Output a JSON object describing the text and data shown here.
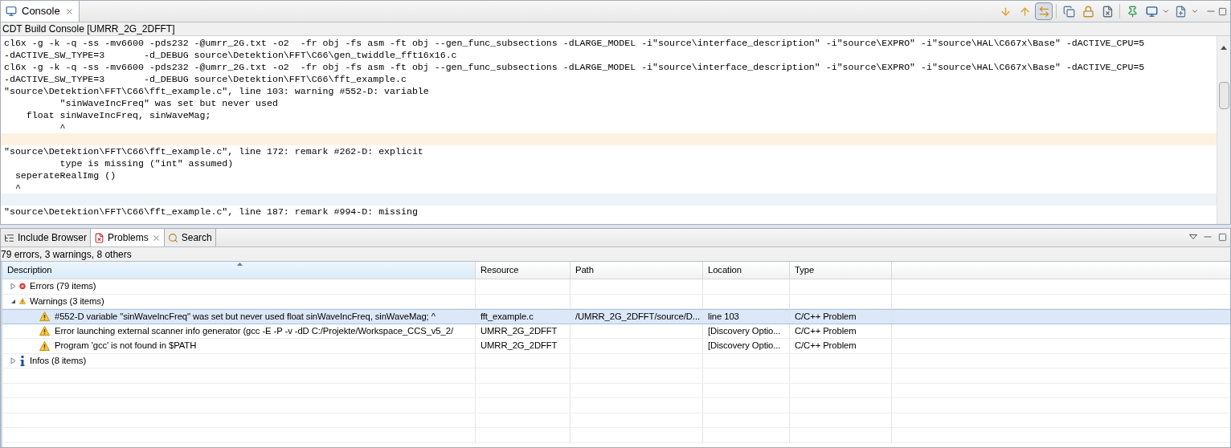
{
  "console": {
    "tab": {
      "label": "Console",
      "selected": true
    },
    "toolbar": [
      {
        "selected": false
      },
      {
        "selected": false
      },
      {
        "selected": true
      },
      {
        "selected": false
      },
      {
        "selected": false
      },
      {
        "selected": false
      },
      {
        "selected": false
      },
      {
        "selected": false
      },
      {
        "selected": false
      }
    ],
    "title": "CDT Build Console [UMRR_2G_2DFFT]",
    "lines": [
      {
        "kind": "text",
        "text": "cl6x -g -k -q -ss -mv6600 -pds232 -@umrr_2G.txt -o2  -fr obj -fs asm -ft obj --gen_func_subsections -dLARGE_MODEL -i\"source\\interface_description\" -i\"source\\EXPRO\" -i\"source\\HAL\\C667x\\Base\" -dACTIVE_CPU=5"
      },
      {
        "kind": "text",
        "text": "-dACTIVE_SW_TYPE=3       -d_DEBUG source\\Detektion\\FFT\\C66\\gen_twiddle_fft16x16.c"
      },
      {
        "kind": "text",
        "text": "cl6x -g -k -q -ss -mv6600 -pds232 -@umrr_2G.txt -o2  -fr obj -fs asm -ft obj --gen_func_subsections -dLARGE_MODEL -i\"source\\interface_description\" -i\"source\\EXPRO\" -i\"source\\HAL\\C667x\\Base\" -dACTIVE_CPU=5"
      },
      {
        "kind": "text",
        "text": "-dACTIVE_SW_TYPE=3       -d_DEBUG source\\Detektion\\FFT\\C66\\fft_example.c"
      },
      {
        "kind": "text",
        "text": "\"source\\Detektion\\FFT\\C66\\fft_example.c\", line 103: warning #552-D: variable"
      },
      {
        "kind": "text",
        "text": "          \"sinWaveIncFreq\" was set but never used"
      },
      {
        "kind": "text",
        "text": "    float sinWaveIncFreq, sinWaveMag;"
      },
      {
        "kind": "text",
        "text": "          ^"
      },
      {
        "kind": "band",
        "color": "#fdf2e1"
      },
      {
        "kind": "text",
        "text": "\"source\\Detektion\\FFT\\C66\\fft_example.c\", line 172: remark #262-D: explicit"
      },
      {
        "kind": "text",
        "text": "          type is missing (\"int\" assumed)"
      },
      {
        "kind": "text",
        "text": "  seperateRealImg ()"
      },
      {
        "kind": "text",
        "text": "  ^"
      },
      {
        "kind": "band",
        "color": "#eef3fa"
      },
      {
        "kind": "text",
        "text": "\"source\\Detektion\\FFT\\C66\\fft_example.c\", line 187: remark #994-D: missing"
      }
    ]
  },
  "bottom_tabs": [
    {
      "label": "Include Browser",
      "selected": false
    },
    {
      "label": "Problems",
      "selected": true
    },
    {
      "label": "Search",
      "selected": false
    }
  ],
  "problems": {
    "summary": "79 errors, 3 warnings, 8 others",
    "columns": [
      "Description",
      "Resource",
      "Path",
      "Location",
      "Type"
    ],
    "groups": [
      {
        "kind": "error",
        "label": "Errors (79 items)",
        "expanded": false
      },
      {
        "kind": "warning",
        "label": "Warnings (3 items)",
        "expanded": true,
        "children": [
          {
            "description": "#552-D variable \"sinWaveIncFreq\" was set but never used float sinWaveIncFreq, sinWaveMag; ^",
            "resource": "fft_example.c",
            "path": "/UMRR_2G_2DFFT/source/D...",
            "location": "line 103",
            "type": "C/C++ Problem",
            "selected": true
          },
          {
            "description": "Error launching external scanner info generator (gcc -E -P -v -dD C:/Projekte/Workspace_CCS_v5_2/",
            "resource": "UMRR_2G_2DFFT",
            "location": "[Discovery Optio...",
            "type": "C/C++ Problem",
            "selected": false
          },
          {
            "description": "Program 'gcc' is not found in $PATH",
            "resource": "UMRR_2G_2DFFT",
            "location": "[Discovery Optio...",
            "type": "C/C++ Problem",
            "selected": false
          }
        ]
      },
      {
        "kind": "info",
        "label": "Infos (8 items)",
        "expanded": false
      }
    ]
  }
}
